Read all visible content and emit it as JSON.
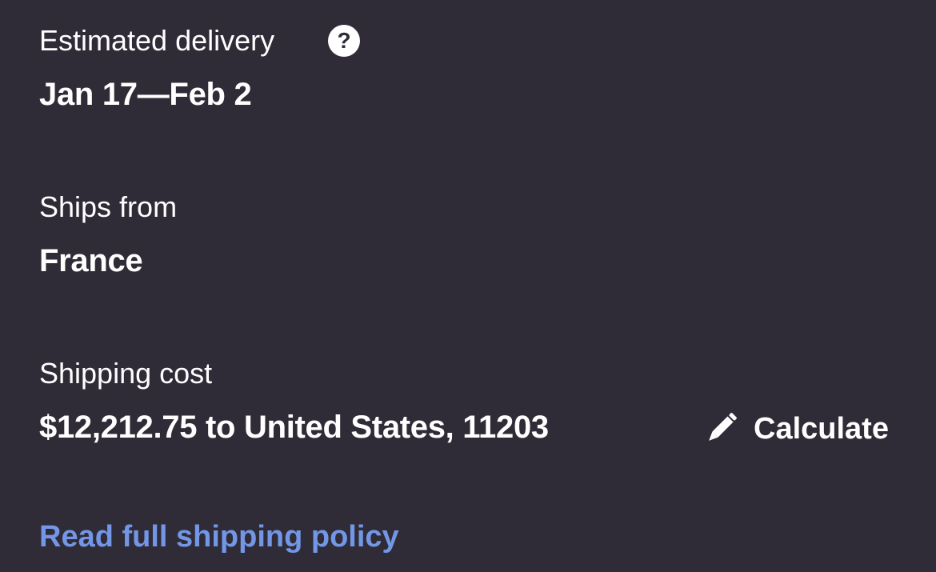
{
  "delivery": {
    "label": "Estimated delivery",
    "help_icon": "question-mark-circle-icon",
    "help_glyph": "?",
    "value": "Jan 17—Feb 2"
  },
  "ships_from": {
    "label": "Ships from",
    "value": "France"
  },
  "shipping_cost": {
    "label": "Shipping cost",
    "value": "$12,212.75 to United States, 11203",
    "calculate_label": "Calculate",
    "calculate_icon": "pencil-icon"
  },
  "policy_link": {
    "label": "Read full shipping policy"
  },
  "colors": {
    "background": "#302c37",
    "text": "#ffffff",
    "link": "#7396e6"
  }
}
